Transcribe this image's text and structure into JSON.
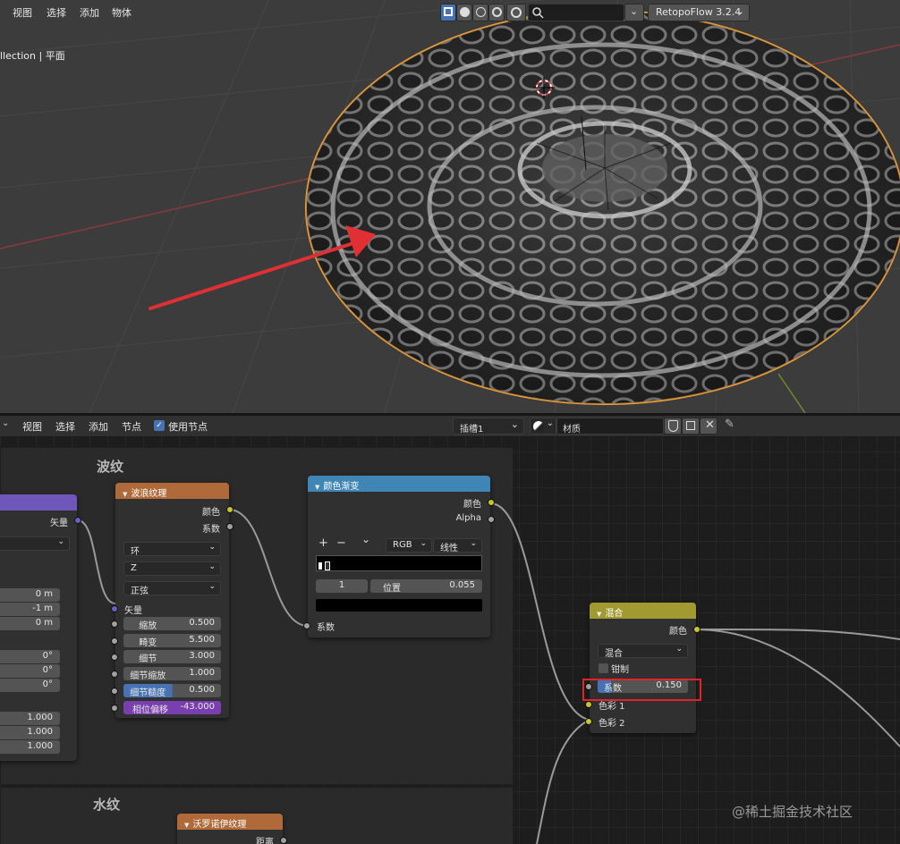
{
  "viewport": {
    "menu": [
      "视图",
      "选择",
      "添加",
      "物体"
    ],
    "collection_label": "llection | 平面",
    "addon_label": "RetopoFlow 3.2.4"
  },
  "node_editor": {
    "menu": [
      "视图",
      "选择",
      "添加",
      "节点"
    ],
    "use_nodes_label": "使用节点",
    "slot_label": "插槽1",
    "material_name": "材质",
    "frame_wave_label": "波纹",
    "frame_water_label": "水纹",
    "watermark": "@稀土掘金技术社区"
  },
  "mapping_node": {
    "output_vector": "矢量",
    "loc": [
      "0 m",
      "-1 m",
      "0 m"
    ],
    "rot": [
      "0°",
      "0°",
      "0°"
    ],
    "scale": [
      "1.000",
      "1.000",
      "1.000"
    ]
  },
  "wave_node": {
    "title": "波浪纹理",
    "out_color": "颜色",
    "out_fac": "系数",
    "type": "环",
    "direction": "Z",
    "profile": "正弦",
    "in_vector": "矢量",
    "params": [
      {
        "label": "缩放",
        "value": "0.500"
      },
      {
        "label": "畸变",
        "value": "5.500"
      },
      {
        "label": "细节",
        "value": "3.000"
      },
      {
        "label": "细节缩放",
        "value": "1.000"
      },
      {
        "label": "细节糙度",
        "value": "0.500"
      },
      {
        "label": "相位偏移",
        "value": "-43.000"
      }
    ]
  },
  "ramp_node": {
    "title": "颜色渐变",
    "out_color": "颜色",
    "out_alpha": "Alpha",
    "plus": "+",
    "minus": "−",
    "chevron": "⌄",
    "color_mode": "RGB",
    "interpolation": "线性",
    "stop_index": "1",
    "pos_label": "位置",
    "pos_value": "0.055",
    "in_fac": "系数"
  },
  "voronoi_node": {
    "title": "沃罗诺伊纹理",
    "out_distance": "距离"
  },
  "mix_node": {
    "title": "混合",
    "out_color": "颜色",
    "blend_type": "混合",
    "clamp_label": "钳制",
    "fac_label": "系数",
    "fac_value": "0.150",
    "fac_fraction": 0.15,
    "color1": "色彩 1",
    "color2": "色彩 2"
  },
  "colors": {
    "texture_header": "#b06a3a",
    "converter_header": "#3f86b7",
    "color_header": "#a09a31",
    "vector_header": "#6e57b8",
    "highlight_box": "#e0242b",
    "arrow": "#e03033",
    "selection_outline": "#f2a23a"
  }
}
